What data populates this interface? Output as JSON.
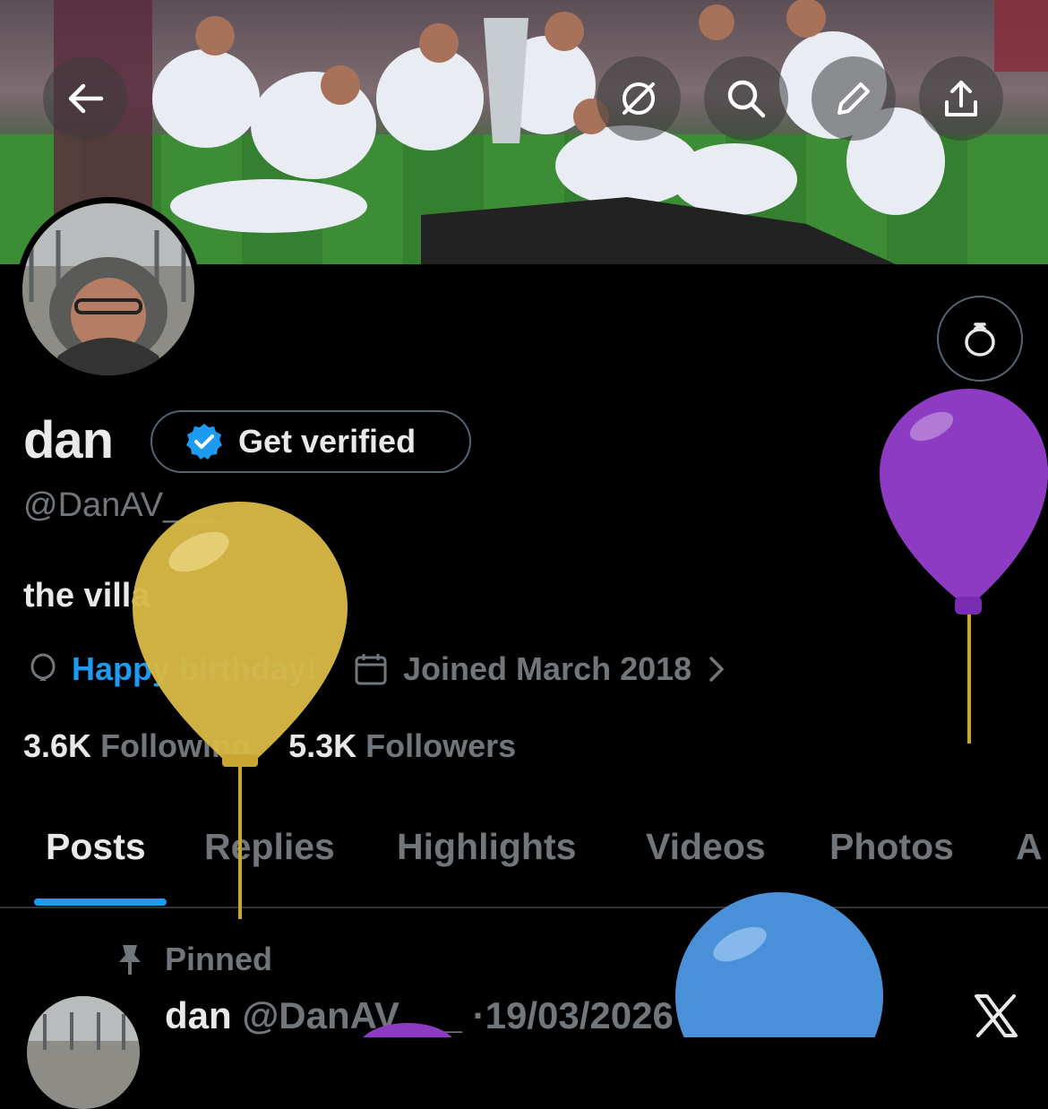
{
  "header": {
    "back_icon": "back-arrow-icon",
    "grok_icon": "grok-icon",
    "search_icon": "search-icon",
    "edit_icon": "pencil-icon",
    "share_icon": "share-icon"
  },
  "profile": {
    "name": "dan",
    "get_verified_label": "Get verified",
    "handle": "@DanAV___",
    "bio": "the villa",
    "birthday_text": "Happy birthday!",
    "joined_text": "Joined March 2018",
    "following_count": "3.6K",
    "following_label": "Following",
    "followers_count": "5.3K",
    "followers_label": "Followers"
  },
  "tabs": [
    {
      "label": "Posts",
      "active": true
    },
    {
      "label": "Replies",
      "active": false
    },
    {
      "label": "Highlights",
      "active": false
    },
    {
      "label": "Videos",
      "active": false
    },
    {
      "label": "Photos",
      "active": false
    },
    {
      "label": "A",
      "active": false
    }
  ],
  "pinned_post": {
    "pinned_label": "Pinned",
    "author_name": "dan",
    "author_handle": "@DanAV___",
    "date": "·19/03/2026"
  },
  "colors": {
    "accent": "#1d9bf0",
    "balloon_yellow": "#d6b845",
    "balloon_purple": "#8e3bc4",
    "balloon_blue": "#4a90d9"
  }
}
